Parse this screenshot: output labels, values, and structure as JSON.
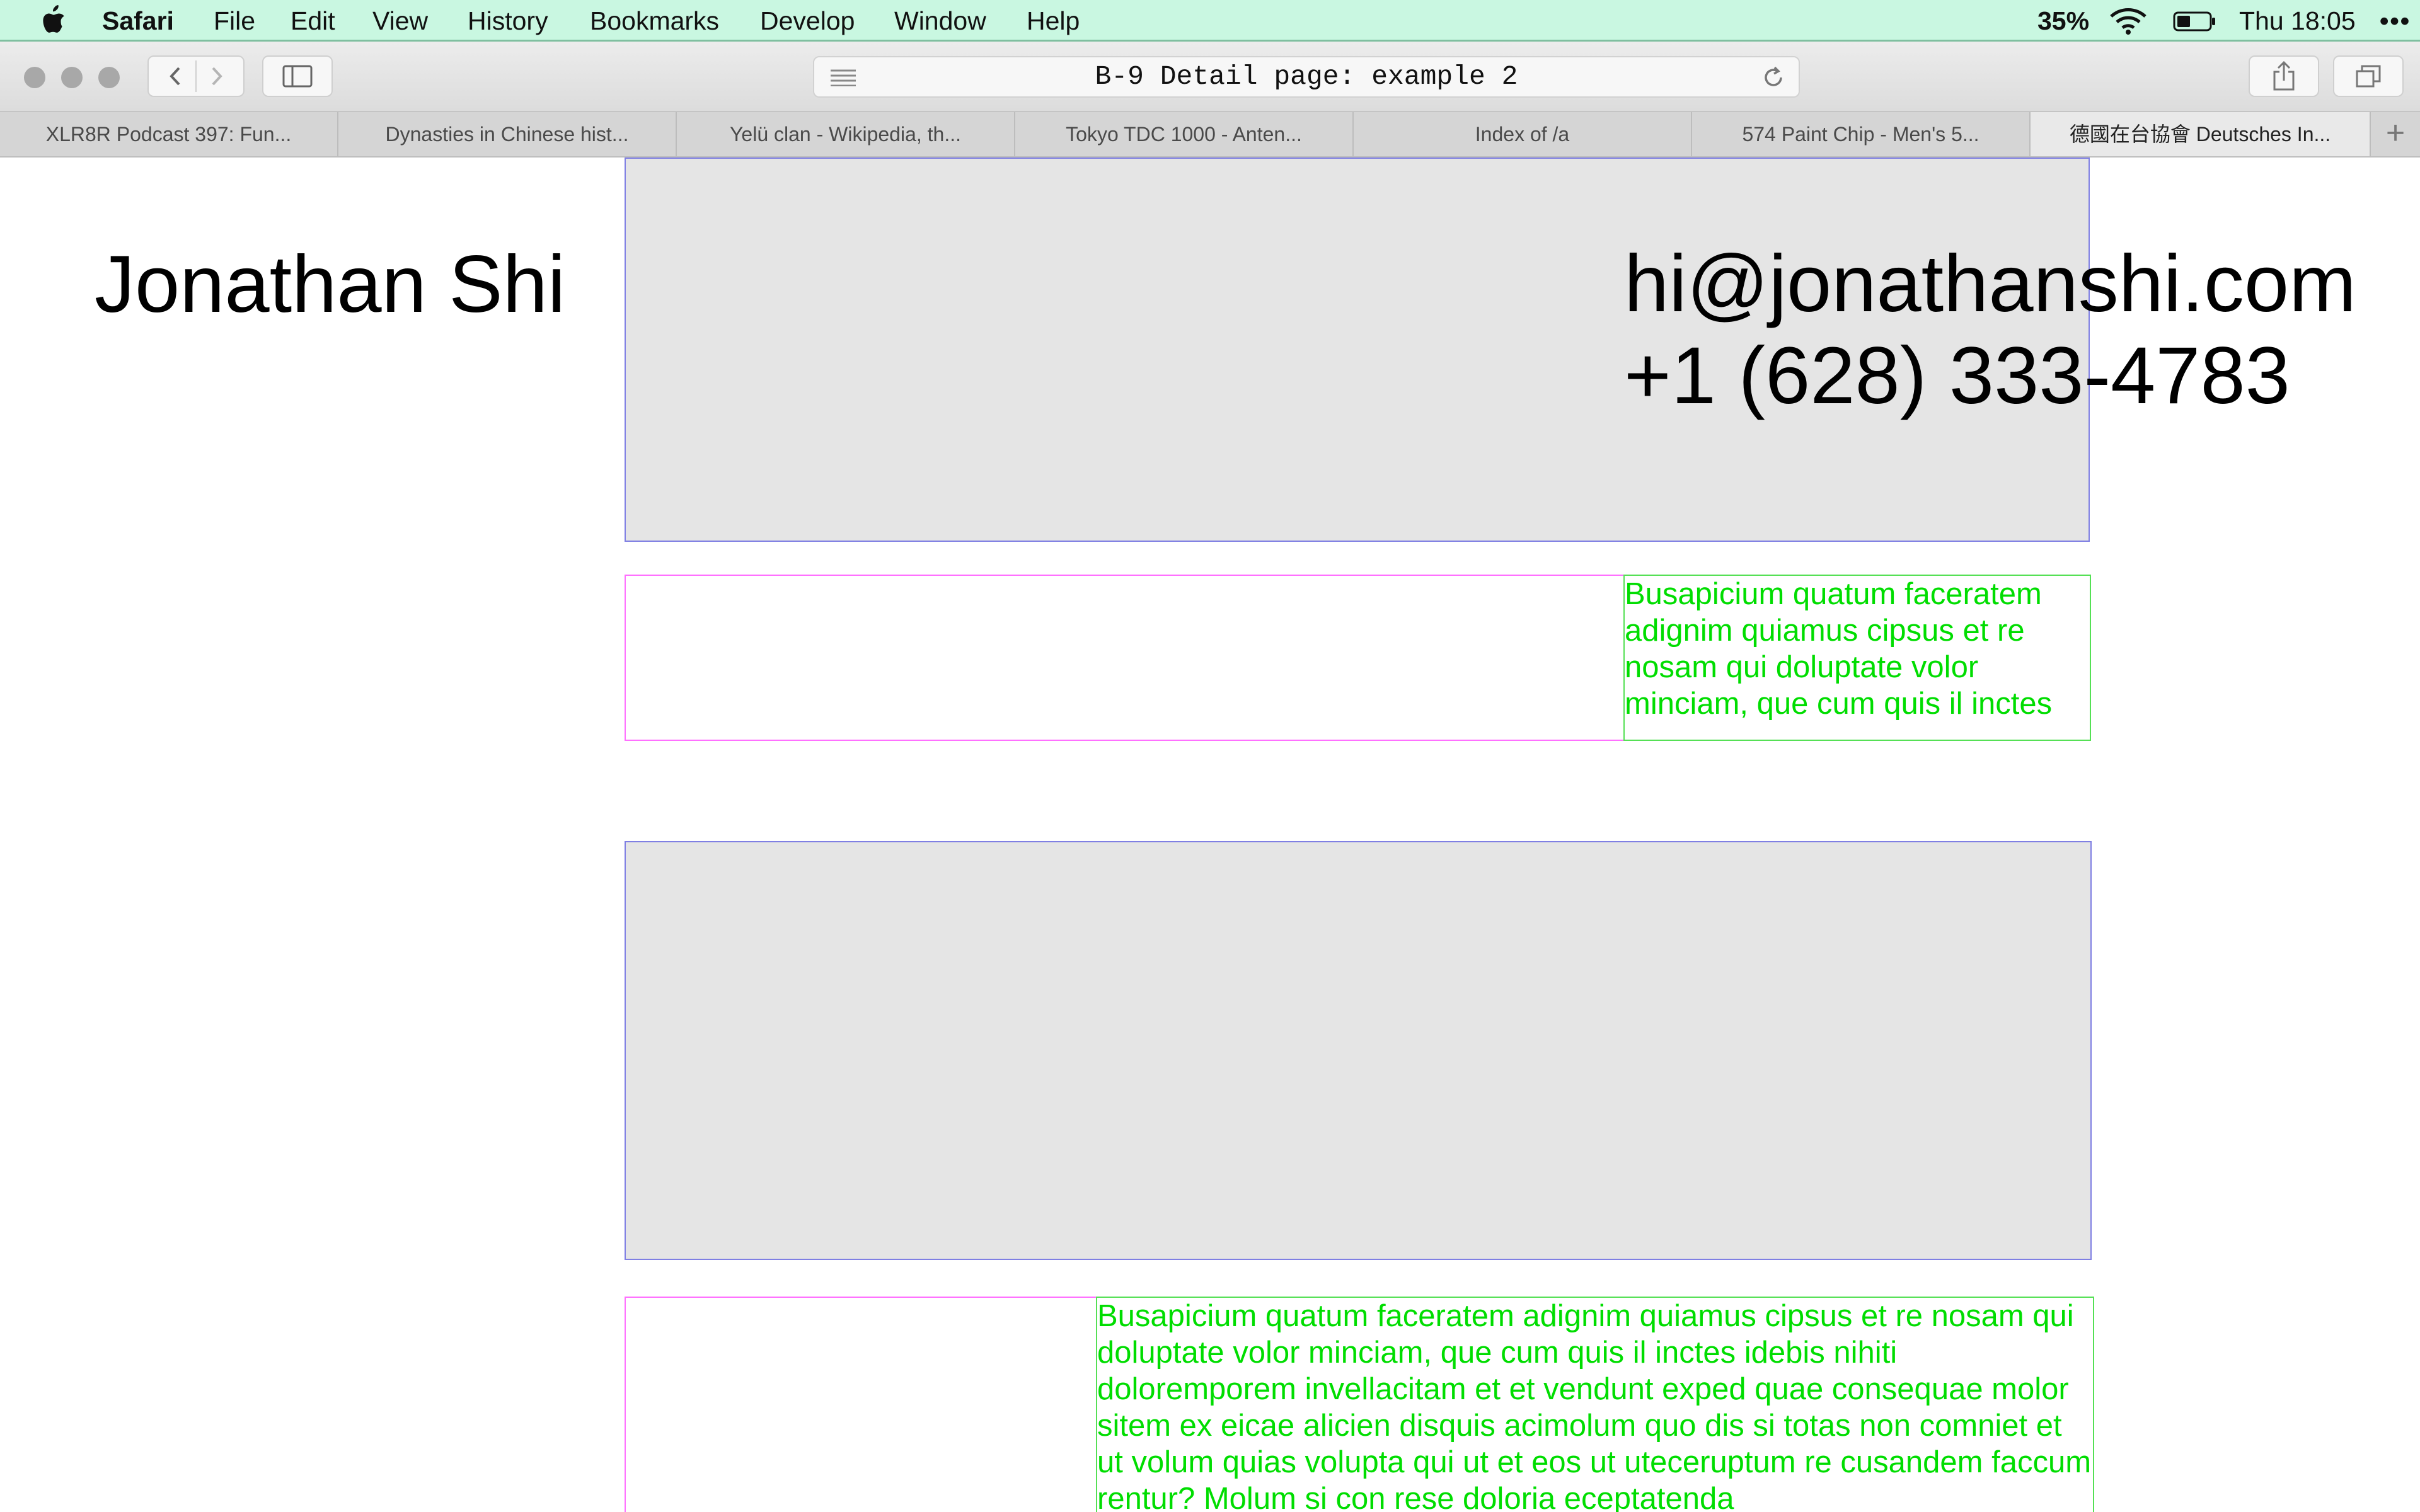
{
  "menubar": {
    "app_name": "Safari",
    "items": [
      "File",
      "Edit",
      "View",
      "History",
      "Bookmarks",
      "Develop",
      "Window",
      "Help"
    ],
    "battery_percent": "35%",
    "clock": "Thu 18:05",
    "more": "•••"
  },
  "toolbar": {
    "url": "B-9 Detail page: example 2"
  },
  "tabs": [
    {
      "label": "XLR8R Podcast 397: Fun..."
    },
    {
      "label": "Dynasties in Chinese hist..."
    },
    {
      "label": "Yelü clan - Wikipedia, th..."
    },
    {
      "label": "Tokyo TDC 1000 - Anten..."
    },
    {
      "label": "Index of /a"
    },
    {
      "label": "574 Paint Chip - Men's 5..."
    },
    {
      "label": "德國在台協會 Deutsches In...",
      "active": true
    }
  ],
  "page": {
    "name": "Jonathan Shi",
    "email": "hi@jonathanshi.com",
    "phone": "+1 (628) 333-4783",
    "caption_1": "Busapicium quatum faceratem adignim quiamus cipsus et re nosam qui doluptate volor minciam, que cum quis il inctes",
    "caption_2": "Busapicium quatum faceratem adignim quiamus cipsus et re nosam qui doluptate volor minciam, que cum quis il inctes idebis nihiti doloremporem invellacitam et et vendunt exped quae consequae molor sitem ex eicae alicien disquis acimolum quo dis si totas non comniet et ut volum quias volupta qui ut et eos ut uteceruptum re cusandem faccum rentur? Molum si con rese doloria eceptatenda"
  },
  "colors": {
    "menubar_bg": "#c9f7e1",
    "placeholder_grey": "#e5e5e5",
    "placeholder_border": "#7f7fe3",
    "pink_outline": "#ff70ff",
    "green_text": "#00dd00"
  }
}
